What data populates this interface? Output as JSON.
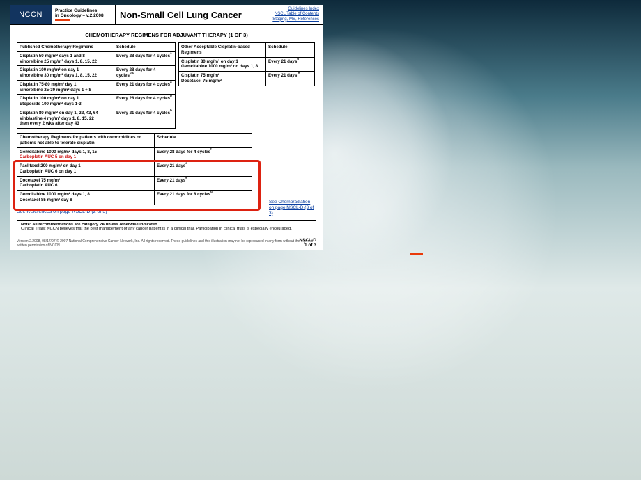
{
  "header": {
    "logo": "NCCN",
    "guideline_l1": "Practice Guidelines",
    "guideline_l2": "in Oncology – v.2.2008",
    "title": "Non-Small Cell Lung Cancer",
    "links": {
      "a": "Guidelines Index",
      "b": "NSCL Table of Contents",
      "c": "Staging, MS, References"
    }
  },
  "section_title": "CHEMOTHERAPY REGIMENS FOR ADJUVANT THERAPY (1 OF 3)",
  "t1": {
    "h1": "Published Chemotherapy Regimens",
    "h2": "Schedule",
    "r": [
      {
        "c1": "Cisplatin 50 mg/m² days 1 and 8<br>Vinorelbine 25 mg/m² days 1, 8, 15, 22",
        "c2": "Every 28 days for 4 cycles",
        "s": "a"
      },
      {
        "c1": "Cisplatin 100 mg/m² on day 1<br>Vinorelbine 30 mg/m² days 1, 8, 15, 22",
        "c2": "Every 28 days for 4 cycles",
        "s": "b,c"
      },
      {
        "c1": "Cisplatin 75-80 mg/m² day 1;<br>Vinorelbine 25-30 mg/m² days 1 + 8",
        "c2": "Every 21 days for 4 cycles",
        "s": "a"
      },
      {
        "c1": "Cisplatin 100 mg/m² on day 1<br>Etoposide 100 mg/m² days 1-3",
        "c2": "Every 28 days for 4 cycles",
        "s": "b"
      },
      {
        "c1": "Cisplatin 80 mg/m² on day 1, 22, 43, 64<br>Vinblastine 4 mg/m² days 1, 8, 15, 22<br>then every 2 wks after day 43",
        "c2": "Every 21 days for 4 cycles",
        "s": "b"
      }
    ]
  },
  "t2": {
    "h1": "Other Acceptable Cisplatin-based Regimens",
    "h2": "Schedule",
    "r": [
      {
        "c1": "Cisplatin 80 mg/m² on day 1<br>Gemcitabine 1000 mg/m² on days 1, 8",
        "c2": "Every 21 days",
        "s": "d"
      },
      {
        "c1": "Cisplatin 75 mg/m²<br>Docetaxel 75 mg/m²",
        "c2": "Every 21 days ",
        "s": "e"
      }
    ]
  },
  "t3": {
    "h1": "Chemotherapy Regimens for patients with comorbidities or patients not able to tolerate cisplatin",
    "h2": "Schedule",
    "r": [
      {
        "c1": "Gemcitabine 1000 mg/m² days 1, 8, 15<br><span class='redcut'>Carboplatin AUC 5 on day 1</span>",
        "c2": "Every 28 days for 4 cycles",
        "s": "f"
      },
      {
        "c1": "Paclitaxel 200 mg/m² on day 1<br>Carboplatin AUC 6 on day 1",
        "c2": "Every 21 days",
        "s": "d"
      },
      {
        "c1": "Docetaxel 75 mg/m²<br>Carboplatin AUC 6",
        "c2": "Every 21 days",
        "s": "e"
      },
      {
        "c1": "Gemcitabine 1000 mg/m² days 1, 8<br>Docetaxel 85 mg/m² day 8",
        "c2": "Every 21 days for 8 cycles",
        "s": "g"
      }
    ]
  },
  "links2": {
    "ref": "See References on page NSCL-D (2 of 3)",
    "side": "See Chemoradiation on page NSCL-D (3 of 3)"
  },
  "note": {
    "l1": "Note: All recommendations are category 2A unless otherwise indicated.",
    "l2": "Clinical Trials: NCCN believes that the best management of any cancer patient is in a clinical trial. Participation in clinical trials is especially encouraged."
  },
  "footer": {
    "version": "Version 2.2008, 08/17/07 © 2007 National Comprehensive Cancer Network, Inc. All rights reserved. These guidelines and this illustration may not be reproduced in any form without the express written permission of NCCN.",
    "page_id": "NSCL-D",
    "page_num": "1 of 3"
  }
}
